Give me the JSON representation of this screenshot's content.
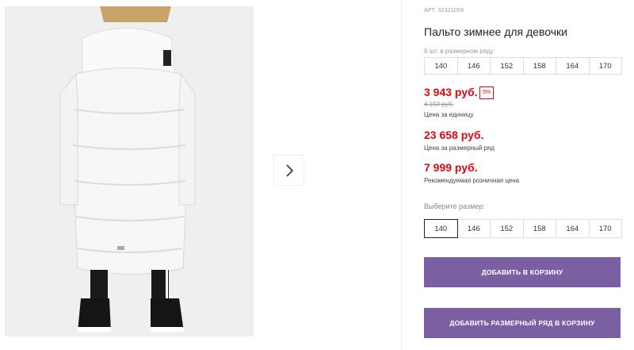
{
  "product": {
    "article": "АРТ. 32321058",
    "title": "Пальто зимнее для девочки",
    "pack_note": "6 шт. в размерном ряду",
    "sizes": [
      "140",
      "146",
      "152",
      "158",
      "164",
      "170"
    ],
    "selected_size": "140"
  },
  "prices": {
    "unit_price": "3 943 руб.",
    "discount": "5%",
    "old_price": "4 150 руб.",
    "unit_label": "Цена за единицу",
    "row_price": "23 658 руб.",
    "row_label": "Цена за размерный ряд",
    "retail_price": "7 999 руб.",
    "retail_label": "Рекомендуемая розничная цена"
  },
  "size_picker": {
    "label": "Выберите размер:"
  },
  "actions": {
    "add_to_cart": "ДОБАВИТЬ В КОРЗИНУ",
    "add_pack_to_cart": "ДОБАВИТЬ РАЗМЕРНЫЙ РЯД В КОРЗИНУ"
  },
  "colors": {
    "price_red": "#e30613",
    "button_purple": "#7b5fa3",
    "photo_bg": "#f0f0f0"
  },
  "icons": {
    "next": "chevron-right-icon"
  }
}
